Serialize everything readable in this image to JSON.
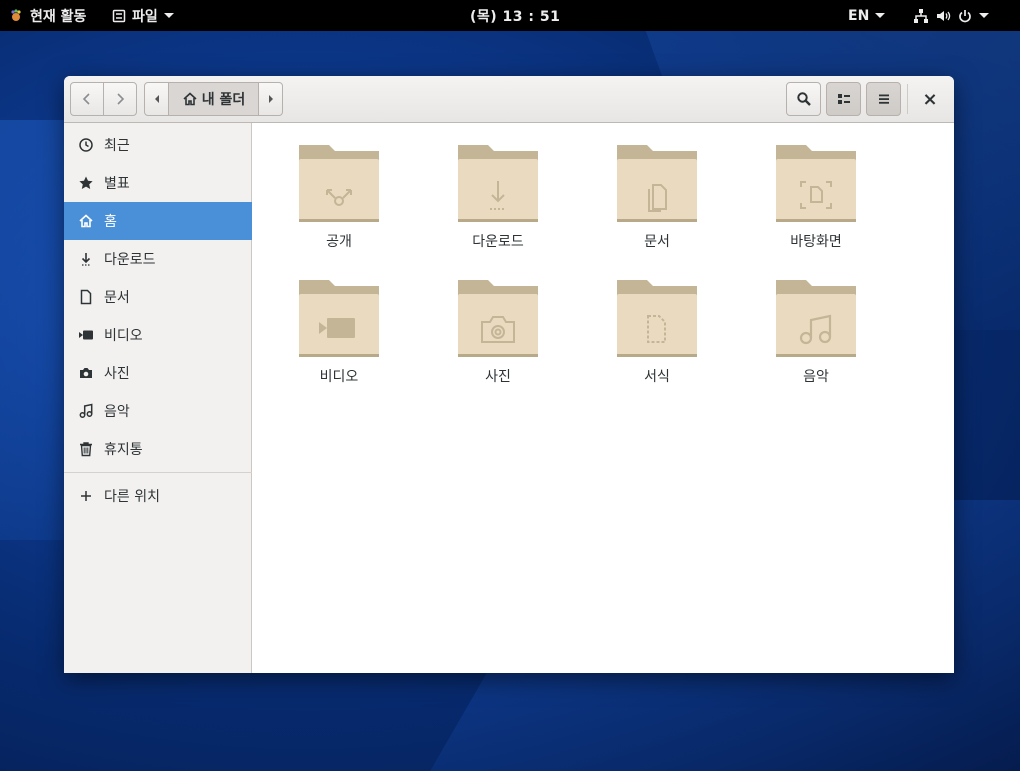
{
  "topbar": {
    "activities": "현재 활동",
    "app_menu": "파일",
    "clock": "(목) 13 : 51",
    "language": "EN"
  },
  "window": {
    "path_label": "내 폴더",
    "close_symbol": "×"
  },
  "sidebar": {
    "items": [
      {
        "label": "최근",
        "icon": "clock-icon"
      },
      {
        "label": "별표",
        "icon": "star-icon"
      },
      {
        "label": "홈",
        "icon": "home-icon",
        "selected": true
      },
      {
        "label": "다운로드",
        "icon": "download-icon"
      },
      {
        "label": "문서",
        "icon": "document-icon"
      },
      {
        "label": "비디오",
        "icon": "video-icon"
      },
      {
        "label": "사진",
        "icon": "camera-icon"
      },
      {
        "label": "음악",
        "icon": "music-icon"
      },
      {
        "label": "휴지통",
        "icon": "trash-icon"
      }
    ],
    "other_locations": "다른 위치"
  },
  "folders": [
    {
      "label": "공개",
      "emblem": "share-icon"
    },
    {
      "label": "다운로드",
      "emblem": "download-icon"
    },
    {
      "label": "문서",
      "emblem": "document-icon"
    },
    {
      "label": "바탕화면",
      "emblem": "desktop-icon"
    },
    {
      "label": "비디오",
      "emblem": "video-icon"
    },
    {
      "label": "사진",
      "emblem": "camera-icon"
    },
    {
      "label": "서식",
      "emblem": "template-icon"
    },
    {
      "label": "음악",
      "emblem": "music-icon"
    }
  ],
  "colors": {
    "selection": "#4a90d9",
    "folder_back": "#c3b596",
    "folder_front": "#eadbc0",
    "topbar": "#000000"
  }
}
